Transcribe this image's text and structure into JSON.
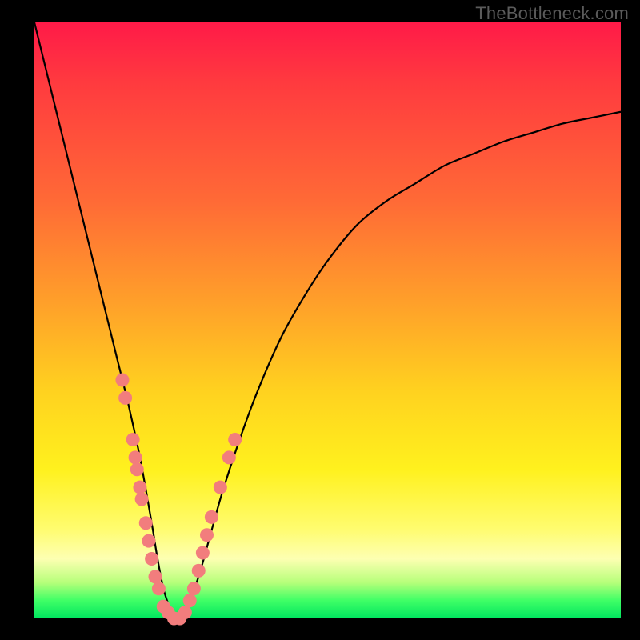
{
  "watermark": "TheBottleneck.com",
  "colors": {
    "background": "#000000",
    "curve": "#000000",
    "dot_fill": "#f27d7d",
    "dot_stroke": "#c94b4b"
  },
  "chart_data": {
    "type": "line",
    "title": "",
    "xlabel": "",
    "ylabel": "",
    "xlim": [
      0,
      100
    ],
    "ylim": [
      0,
      100
    ],
    "series": [
      {
        "name": "bottleneck-curve",
        "x": [
          0,
          2,
          4,
          6,
          8,
          10,
          12,
          14,
          16,
          18,
          20,
          21,
          22,
          23,
          24,
          25,
          26,
          28,
          30,
          32,
          35,
          38,
          42,
          46,
          50,
          55,
          60,
          65,
          70,
          75,
          80,
          85,
          90,
          95,
          100
        ],
        "y": [
          100,
          92,
          84,
          76,
          68,
          60,
          52,
          44,
          36,
          27,
          16,
          10,
          5,
          2,
          0,
          0,
          2,
          7,
          14,
          21,
          30,
          38,
          47,
          54,
          60,
          66,
          70,
          73,
          76,
          78,
          80,
          81.5,
          83,
          84,
          85
        ]
      }
    ],
    "dots": [
      {
        "x": 15.0,
        "y": 40
      },
      {
        "x": 15.5,
        "y": 37
      },
      {
        "x": 16.8,
        "y": 30
      },
      {
        "x": 17.2,
        "y": 27
      },
      {
        "x": 17.5,
        "y": 25
      },
      {
        "x": 18.0,
        "y": 22
      },
      {
        "x": 18.3,
        "y": 20
      },
      {
        "x": 19.0,
        "y": 16
      },
      {
        "x": 19.5,
        "y": 13
      },
      {
        "x": 20.0,
        "y": 10
      },
      {
        "x": 20.6,
        "y": 7
      },
      {
        "x": 21.2,
        "y": 5
      },
      {
        "x": 22.0,
        "y": 2
      },
      {
        "x": 22.8,
        "y": 1
      },
      {
        "x": 23.8,
        "y": 0
      },
      {
        "x": 24.8,
        "y": 0
      },
      {
        "x": 25.7,
        "y": 1
      },
      {
        "x": 26.5,
        "y": 3
      },
      {
        "x": 27.2,
        "y": 5
      },
      {
        "x": 28.0,
        "y": 8
      },
      {
        "x": 28.7,
        "y": 11
      },
      {
        "x": 29.4,
        "y": 14
      },
      {
        "x": 30.2,
        "y": 17
      },
      {
        "x": 31.7,
        "y": 22
      },
      {
        "x": 33.2,
        "y": 27
      },
      {
        "x": 34.2,
        "y": 30
      }
    ]
  }
}
